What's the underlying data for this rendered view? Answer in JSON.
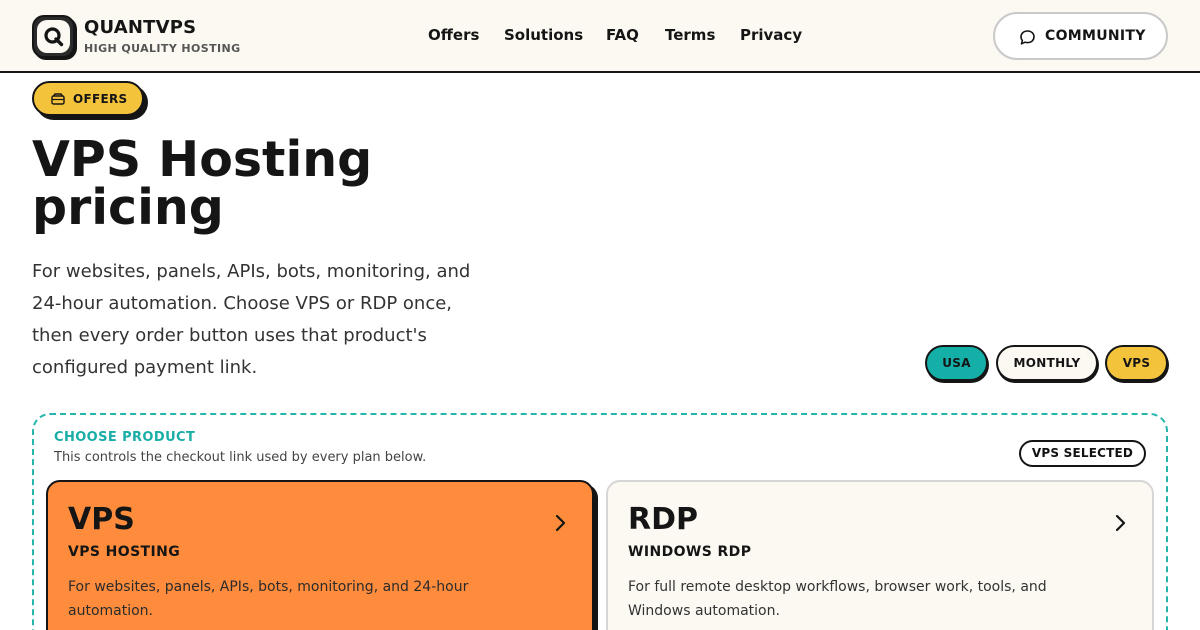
{
  "brand": {
    "name": "QUANTVPS",
    "tagline": "HIGH QUALITY HOSTING",
    "logo_letter": "Q"
  },
  "nav": {
    "items": [
      {
        "label": "Offers"
      },
      {
        "label": "Solutions"
      },
      {
        "label": "FAQ"
      },
      {
        "label": "Terms"
      },
      {
        "label": "Privacy"
      }
    ],
    "community_label": "COMMUNITY",
    "community_icon": "chat-bubble-icon"
  },
  "hero": {
    "pill_label": "OFFERS",
    "pill_icon": "box-icon",
    "title_line1": "VPS Hosting",
    "title_line2": "pricing",
    "description": "For websites, panels, APIs, bots, monitoring, and 24-hour automation. Choose VPS or RDP once, then every order button uses that product's configured payment link."
  },
  "filters": {
    "region": "USA",
    "billing": "MONTHLY",
    "product": "VPS"
  },
  "chooser": {
    "title": "CHOOSE PRODUCT",
    "subtitle": "This controls the checkout link used by every plan below.",
    "selected_badge": "VPS SELECTED",
    "products": [
      {
        "name": "VPS",
        "type": "VPS HOSTING",
        "description": "For websites, panels, APIs, bots, monitoring, and 24-hour automation.",
        "selected": true
      },
      {
        "name": "RDP",
        "type": "WINDOWS RDP",
        "description": "For full remote desktop workflows, browser work, tools, and Windows automation.",
        "selected": false
      }
    ]
  },
  "colors": {
    "accent_yellow": "#f4c33c",
    "accent_teal": "#14b0a8",
    "accent_orange": "#ff8c3c",
    "ink": "#151515",
    "cream": "#fbf9f2"
  }
}
